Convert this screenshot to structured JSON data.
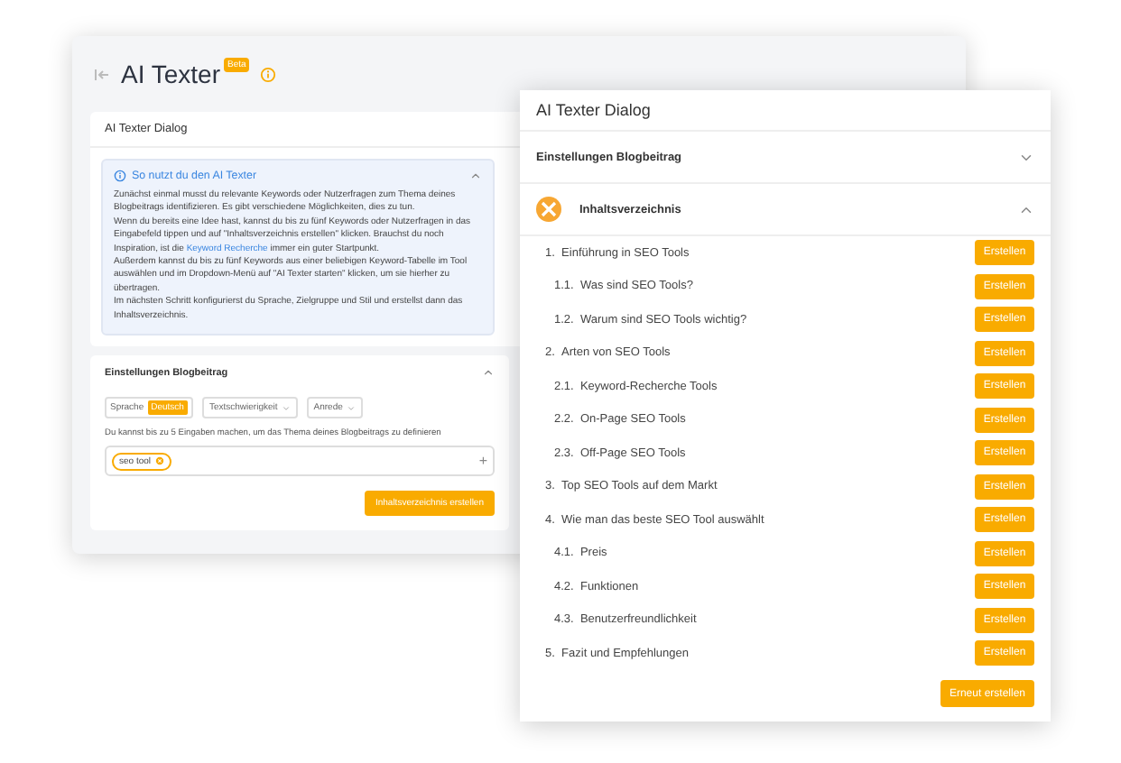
{
  "back_window": {
    "title": "AI Texter",
    "badge": "Beta",
    "dialog_title": "AI Texter Dialog",
    "info": {
      "title": "So nutzt du den AI Texter",
      "expanded": true,
      "paragraphs": [
        [
          {
            "text": "Zunächst einmal musst du relevante Keywords oder Nutzerfragen zum Thema deines Blogbeitrags identifizieren. Es gibt verschiedene Möglichkeiten, dies zu tun.",
            "link": false
          }
        ],
        [
          {
            "text": "Wenn du bereits eine Idee hast, kannst du bis zu fünf Keywords oder Nutzerfragen in das Eingabefeld tippen und auf \"Inhaltsverzeichnis erstellen\" klicken. Brauchst du noch Inspiration, ist die ",
            "link": false
          },
          {
            "text": "Keyword Recherche",
            "link": true
          },
          {
            "text": " immer ein guter Startpunkt.",
            "link": false
          }
        ],
        [
          {
            "text": "Außerdem kannst du bis zu fünf Keywords aus einer beliebigen Keyword-Tabelle im Tool auswählen und im Dropdown-Menü auf \"AI Texter starten\" klicken, um sie hierher zu übertragen.",
            "link": false
          }
        ],
        [
          {
            "text": "Im nächsten Schritt konfigurierst du Sprache, Zielgruppe und Stil und erstellst dann das Inhaltsverzeichnis.",
            "link": false
          }
        ]
      ]
    },
    "settings": {
      "title": "Einstellungen Blogbeitrag",
      "expanded": true,
      "language_label": "Sprache",
      "language_value": "Deutsch",
      "dropdowns": [
        "Textschwierigkeit",
        "Anrede"
      ],
      "hint": "Du kannst bis zu 5 Eingaben machen, um das Thema deines Blogbeitrags zu definieren",
      "tags": [
        "seo tool"
      ],
      "add": "+",
      "button": "Inhaltsverzeichnis erstellen"
    }
  },
  "front_dialog": {
    "title": "AI Texter Dialog",
    "sections": [
      {
        "title": "Einstellungen Blogbeitrag",
        "expanded": false,
        "kind": "plain"
      },
      {
        "title": "Inhaltsverzeichnis",
        "expanded": true,
        "kind": "icon"
      }
    ],
    "outline": [
      {
        "number": "1.",
        "label": "Einführung in SEO Tools",
        "button": "Erstellen",
        "children": [
          {
            "number": "1.1.",
            "label": "Was sind SEO Tools?",
            "button": "Erstellen"
          },
          {
            "number": "1.2.",
            "label": "Warum sind SEO Tools wichtig?",
            "button": "Erstellen"
          }
        ]
      },
      {
        "number": "2.",
        "label": "Arten von SEO Tools",
        "button": "Erstellen",
        "children": [
          {
            "number": "2.1.",
            "label": "Keyword-Recherche Tools",
            "button": "Erstellen"
          },
          {
            "number": "2.2.",
            "label": "On-Page SEO Tools",
            "button": "Erstellen"
          },
          {
            "number": "2.3.",
            "label": "Off-Page SEO Tools",
            "button": "Erstellen"
          }
        ]
      },
      {
        "number": "3.",
        "label": "Top SEO Tools auf dem Markt",
        "button": "Erstellen"
      },
      {
        "number": "4.",
        "label": "Wie man das beste SEO Tool auswählt",
        "button": "Erstellen",
        "children": [
          {
            "number": "4.1.",
            "label": "Preis",
            "button": "Erstellen"
          },
          {
            "number": "4.2.",
            "label": "Funktionen",
            "button": "Erstellen"
          },
          {
            "number": "4.3.",
            "label": "Benutzerfreundlichkeit",
            "button": "Erstellen"
          }
        ]
      },
      {
        "number": "5.",
        "label": "Fazit und Empfehlungen",
        "button": "Erstellen"
      }
    ],
    "regenerate_button": "Erneut erstellen"
  }
}
